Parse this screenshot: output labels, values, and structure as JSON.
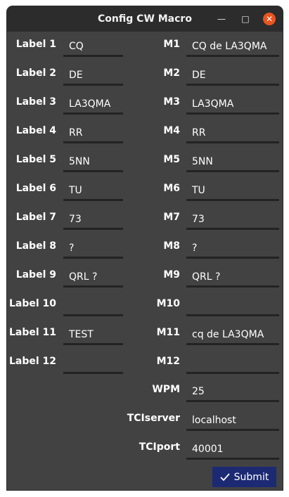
{
  "window": {
    "title": "Config CW Macro"
  },
  "labels": [
    "Label 1",
    "Label 2",
    "Label 3",
    "Label 4",
    "Label 5",
    "Label 6",
    "Label 7",
    "Label 8",
    "Label 9",
    "Label 10",
    "Label 11",
    "Label 12"
  ],
  "label_values": [
    "CQ",
    "DE",
    "LA3QMA",
    "RR",
    "5NN",
    "TU",
    "73",
    "?",
    "QRL ?",
    "",
    "TEST",
    ""
  ],
  "macros": [
    "M1",
    "M2",
    "M3",
    "M4",
    "M5",
    "M6",
    "M7",
    "M8",
    "M9",
    "M10",
    "M11",
    "M12"
  ],
  "macro_values": [
    "CQ de LA3QMA",
    "DE",
    "LA3QMA",
    "RR",
    "5NN",
    "TU",
    "73",
    "?",
    "QRL ?",
    "",
    "cq de LA3QMA",
    ""
  ],
  "settings": {
    "wpm_label": "WPM",
    "wpm_value": "25",
    "tciserver_label": "TCIserver",
    "tciserver_value": "localhost",
    "tciport_label": "TCIport",
    "tciport_value": "40001"
  },
  "submit_label": "Submit",
  "icons": {
    "minimize": "minimize-icon",
    "maximize": "maximize-icon",
    "close": "close-icon",
    "submit": "checkmark-icon"
  }
}
